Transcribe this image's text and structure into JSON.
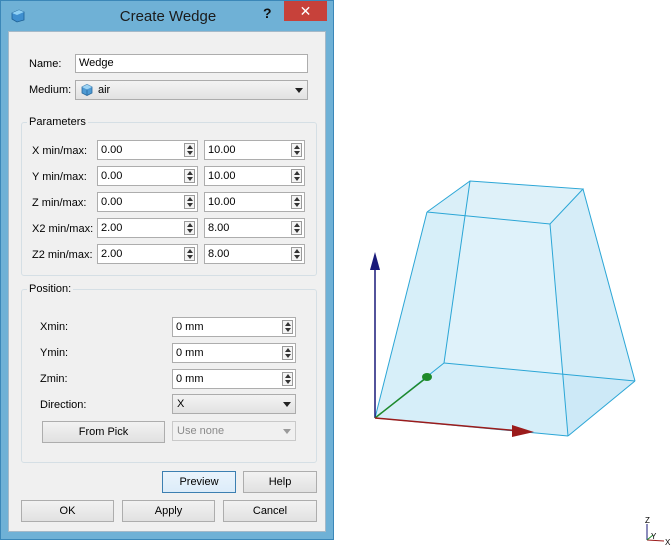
{
  "dialog": {
    "title": "Create Wedge",
    "help_icon": "?",
    "close_icon": "✕",
    "name_label": "Name:",
    "name_value": "Wedge",
    "medium_label": "Medium:",
    "medium_value": "air",
    "parameters": {
      "title": "Parameters",
      "rows": [
        {
          "label": "X min/max:",
          "min": "0.00",
          "max": "10.00"
        },
        {
          "label": "Y min/max:",
          "min": "0.00",
          "max": "10.00"
        },
        {
          "label": "Z min/max:",
          "min": "0.00",
          "max": "10.00"
        },
        {
          "label": "X2 min/max:",
          "min": "2.00",
          "max": "8.00"
        },
        {
          "label": "Z2 min/max:",
          "min": "2.00",
          "max": "8.00"
        }
      ]
    },
    "position": {
      "title": "Position:",
      "xmin_label": "Xmin:",
      "xmin_value": "0 mm",
      "ymin_label": "Ymin:",
      "ymin_value": "0 mm",
      "zmin_label": "Zmin:",
      "zmin_value": "0 mm",
      "direction_label": "Direction:",
      "direction_value": "X",
      "from_pick_label": "From Pick",
      "use_value": "Use none"
    },
    "buttons": {
      "preview": "Preview",
      "help": "Help",
      "ok": "OK",
      "apply": "Apply",
      "cancel": "Cancel"
    }
  },
  "viewport": {
    "mini_axes": {
      "z": "Z",
      "y": "Y",
      "x": "X"
    },
    "colors": {
      "x_axis": "#9b1b1b",
      "y_axis": "#1f8a2a",
      "z_axis": "#1a1a7a",
      "wedge_edge": "#2ba6d6",
      "wedge_fill": "#cdeaf7"
    }
  }
}
